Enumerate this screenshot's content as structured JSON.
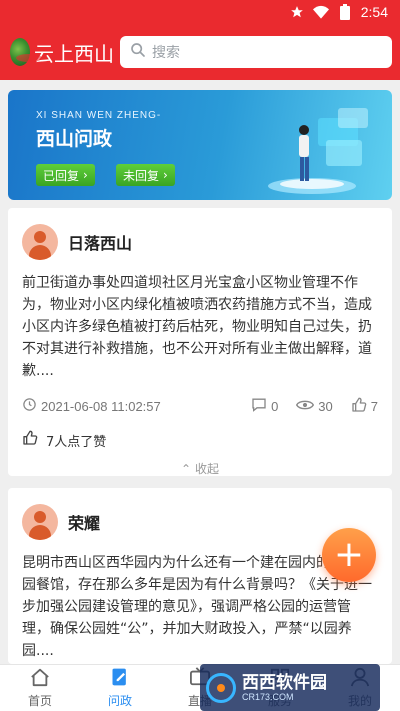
{
  "status_bar": {
    "time": "2:54",
    "icons": [
      "star-icon",
      "wifi-icon",
      "battery-icon"
    ]
  },
  "header": {
    "logo_text": "云上西山",
    "search_placeholder": "搜索"
  },
  "banner": {
    "subtitle": "XI SHAN WEN ZHENG-",
    "title": "西山问政",
    "buttons": [
      {
        "label": "已回复"
      },
      {
        "label": "未回复"
      }
    ]
  },
  "posts": [
    {
      "author": "日落西山",
      "content": "前卫街道办事处四道坝社区月光宝盒小区物业管理不作为，物业对小区内绿化植被喷洒农药措施方式不当，造成小区内许多绿色植被打药后枯死，物业明知自己过失，扔不对其进行补救措施，也不公开对所有业主做出解释，道歉....",
      "date": "2021-06-08 11:02:57",
      "comments": "0",
      "views": "30",
      "likes": "7",
      "like_summary": "7人点了赞",
      "collapse_label": "收起"
    },
    {
      "author": "荣耀",
      "content": "昆明市西山区西华园内为什么还有一个建在园内的山水花园餐馆，存在那么多年是因为有什么背景吗？《关于进一步加强公园建设管理的意见》，强调严格公园的运营管理，确保公园姓“公”，并加大财政投入，严禁“以园养园...."
    }
  ],
  "fab": {
    "label": "+"
  },
  "tabs": [
    {
      "label": "首页",
      "icon": "home-icon"
    },
    {
      "label": "问政",
      "icon": "edit-icon"
    },
    {
      "label": "直播",
      "icon": "live-icon"
    },
    {
      "label": "服务",
      "icon": "service-icon"
    },
    {
      "label": "我的",
      "icon": "user-icon"
    }
  ],
  "watermark": {
    "text": "西西软件园",
    "url": "CR173.COM"
  },
  "colors": {
    "brand_red": "#ea2a2f",
    "accent_blue": "#2b8ef0",
    "fab_orange": "#ff7a30",
    "chip_green": "#4bb92e"
  }
}
